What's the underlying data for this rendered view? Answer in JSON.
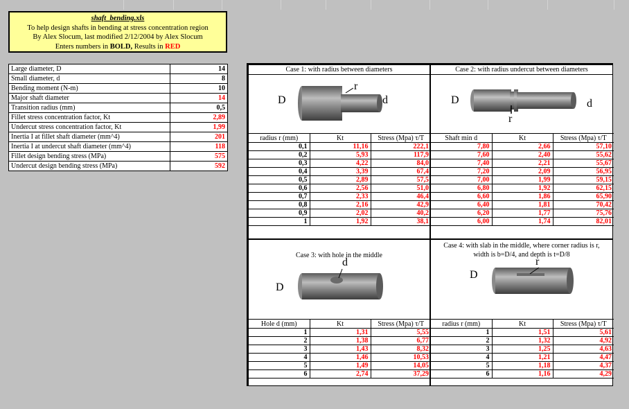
{
  "title": {
    "filename": "shaft_bending.xls",
    "line2": "To help design shafts in bending at stress concentration region",
    "line3": "By Alex Slocum, last modified 2/12/2004 by Alex Slocum",
    "line4_pre": "Enters numbers in ",
    "line4_bold": "BOLD,",
    "line4_mid": " Results in ",
    "line4_red": "RED"
  },
  "inputs": [
    {
      "label": "Large diameter, D",
      "value": "14",
      "color": "black"
    },
    {
      "label": "Small diameter, d",
      "value": "8",
      "color": "black"
    },
    {
      "label": "Bending moment (N-m)",
      "value": "10",
      "color": "black"
    },
    {
      "label": "Major shaft diameter",
      "value": "14",
      "color": "red"
    },
    {
      "label": "Transition radius (mm)",
      "value": "0,5",
      "color": "black"
    },
    {
      "label": "Fillet stress concentration factor, Kt",
      "value": "2,89",
      "color": "red"
    },
    {
      "label": "Undercut stress concentration factor, Kt",
      "value": "1,99",
      "color": "red"
    },
    {
      "label": "Inertia I at fillet shaft diameter (mm^4)",
      "value": "201",
      "color": "red"
    },
    {
      "label": "Inertia I at undercut shaft diameter (mm^4)",
      "value": "118",
      "color": "red"
    },
    {
      "label": "Fillet design bending stress (MPa)",
      "value": "575",
      "color": "red"
    },
    {
      "label": "Undercut design bending stress (MPa)",
      "value": "592",
      "color": "red"
    }
  ],
  "case1": {
    "title": "Case 1: with radius between diameters",
    "label_D": "D",
    "label_d": "d",
    "label_r": "r",
    "headers": [
      "radius r (mm)",
      "Kt",
      "Stress (Mpa) τ/T"
    ],
    "rows": [
      [
        "0,1",
        "11,16",
        "222,1"
      ],
      [
        "0,2",
        "5,93",
        "117,9"
      ],
      [
        "0,3",
        "4,22",
        "84,0"
      ],
      [
        "0,4",
        "3,39",
        "67,4"
      ],
      [
        "0,5",
        "2,89",
        "57,5"
      ],
      [
        "0,6",
        "2,56",
        "51,0"
      ],
      [
        "0,7",
        "2,33",
        "46,4"
      ],
      [
        "0,8",
        "2,16",
        "42,9"
      ],
      [
        "0,9",
        "2,02",
        "40,2"
      ],
      [
        "1",
        "1,92",
        "38,1"
      ]
    ]
  },
  "case2": {
    "title": "Case 2: with radius undercut between diameters",
    "label_D": "D",
    "label_d": "d",
    "label_r": "r",
    "headers": [
      "Shaft min d",
      "Kt",
      "Stress (Mpa) τ/T"
    ],
    "rows": [
      [
        "7,80",
        "2,66",
        "57,10"
      ],
      [
        "7,60",
        "2,40",
        "55,62"
      ],
      [
        "7,40",
        "2,21",
        "55,67"
      ],
      [
        "7,20",
        "2,09",
        "56,95"
      ],
      [
        "7,00",
        "1,99",
        "59,15"
      ],
      [
        "6,80",
        "1,92",
        "62,15"
      ],
      [
        "6,60",
        "1,86",
        "65,90"
      ],
      [
        "6,40",
        "1,81",
        "70,42"
      ],
      [
        "6,20",
        "1,77",
        "75,76"
      ],
      [
        "6,00",
        "1,74",
        "82,01"
      ]
    ]
  },
  "case3": {
    "title": "Case 3: with hole in the middle",
    "label_D": "D",
    "label_d": "d",
    "headers": [
      "Hole d (mm)",
      "Kt",
      "Stress (Mpa) τ/T"
    ],
    "rows": [
      [
        "1",
        "1,31",
        "5,55"
      ],
      [
        "2",
        "1,38",
        "6,77"
      ],
      [
        "3",
        "1,43",
        "8,32"
      ],
      [
        "4",
        "1,46",
        "10,53"
      ],
      [
        "5",
        "1,49",
        "14,05"
      ],
      [
        "6",
        "2,74",
        "37,29"
      ]
    ]
  },
  "case4": {
    "title_line1": "Case 4: with slab in the middle, where corner radius is r,",
    "title_line2": "width is b=D/4, and depth is t=D/8",
    "label_D": "D",
    "label_r": "r",
    "headers": [
      "radius r (mm)",
      "Kt",
      "Stress (Mpa) τ/T"
    ],
    "rows": [
      [
        "1",
        "1,51",
        "5,61"
      ],
      [
        "2",
        "1,32",
        "4,92"
      ],
      [
        "3",
        "1,25",
        "4,63"
      ],
      [
        "4",
        "1,21",
        "4,47"
      ],
      [
        "5",
        "1,18",
        "4,37"
      ],
      [
        "6",
        "1,16",
        "4,29"
      ]
    ]
  }
}
